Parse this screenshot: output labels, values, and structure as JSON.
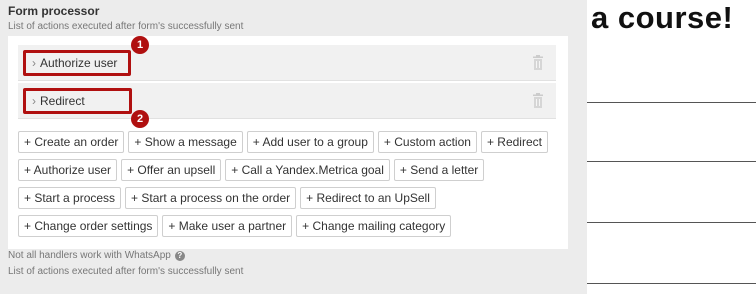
{
  "form_processor": {
    "title": "Form processor",
    "subtitle": "List of actions executed after form's successfully sent",
    "actions": [
      {
        "label": "Authorize user",
        "badge": "1"
      },
      {
        "label": "Redirect",
        "badge": "2"
      }
    ],
    "add_buttons": [
      [
        "+ Create an order",
        "+ Show a message",
        "+ Add user to a group",
        "+ Custom action",
        "+ Redirect"
      ],
      [
        "+ Authorize user",
        "+ Offer an upsell",
        "+ Call a Yandex.Metrica goal",
        "+ Send a letter"
      ],
      [
        "+ Start a process",
        "+ Start a process on the order",
        "+ Redirect to an UpSell"
      ],
      [
        "+ Change order settings",
        "+ Make user a partner",
        "+ Change mailing category"
      ]
    ],
    "note": "Not all handlers work with WhatsApp",
    "footer": "List of actions executed after form's successfully sent"
  },
  "right_panel": {
    "heading": "a course!"
  },
  "colors": {
    "highlight": "#b01010",
    "panel_bg": "#ececec"
  },
  "icons": {
    "chevron": "chevron-right-icon",
    "delete": "trash-icon",
    "help": "question-circle-icon"
  }
}
